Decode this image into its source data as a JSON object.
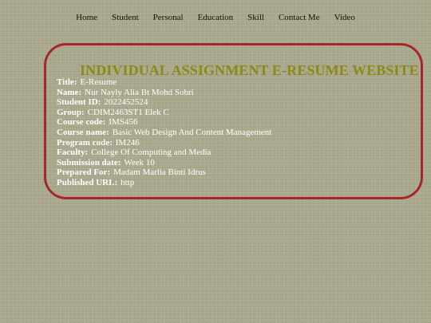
{
  "nav": {
    "items": [
      {
        "label": "Home"
      },
      {
        "label": "Student"
      },
      {
        "label": "Personal"
      },
      {
        "label": "Education"
      },
      {
        "label": "Skill"
      },
      {
        "label": "Contact Me"
      },
      {
        "label": "Video"
      }
    ]
  },
  "card": {
    "title": "INDIVIDUAL ASSIGNMENT E-RESUME WEBSITE",
    "fields": [
      {
        "key": "Title:",
        "value": "E-Resume"
      },
      {
        "key": "Name:",
        "value": "Nur Nayly Alia Bt Mohd Sobri"
      },
      {
        "key": "Student ID:",
        "value": "2022452524"
      },
      {
        "key": "Group:",
        "value": "CDIM2463ST1 Elek C"
      },
      {
        "key": "Course code:",
        "value": "IMS456"
      },
      {
        "key": "Course name:",
        "value": "Basic Web Design And Content Management"
      },
      {
        "key": "Program code:",
        "value": "IM246"
      },
      {
        "key": "Faculty:",
        "value": "College Of Computing and Media"
      },
      {
        "key": "Submission date:",
        "value": "Week 10"
      },
      {
        "key": "Prepared For:",
        "value": "Madam Marlia Binti Idrus"
      },
      {
        "key": "Published URL:",
        "value": "http"
      }
    ]
  },
  "colors": {
    "background": "#a8a78c",
    "border": "#a8262a",
    "title": "#8c8a14",
    "text": "#ffffff"
  }
}
